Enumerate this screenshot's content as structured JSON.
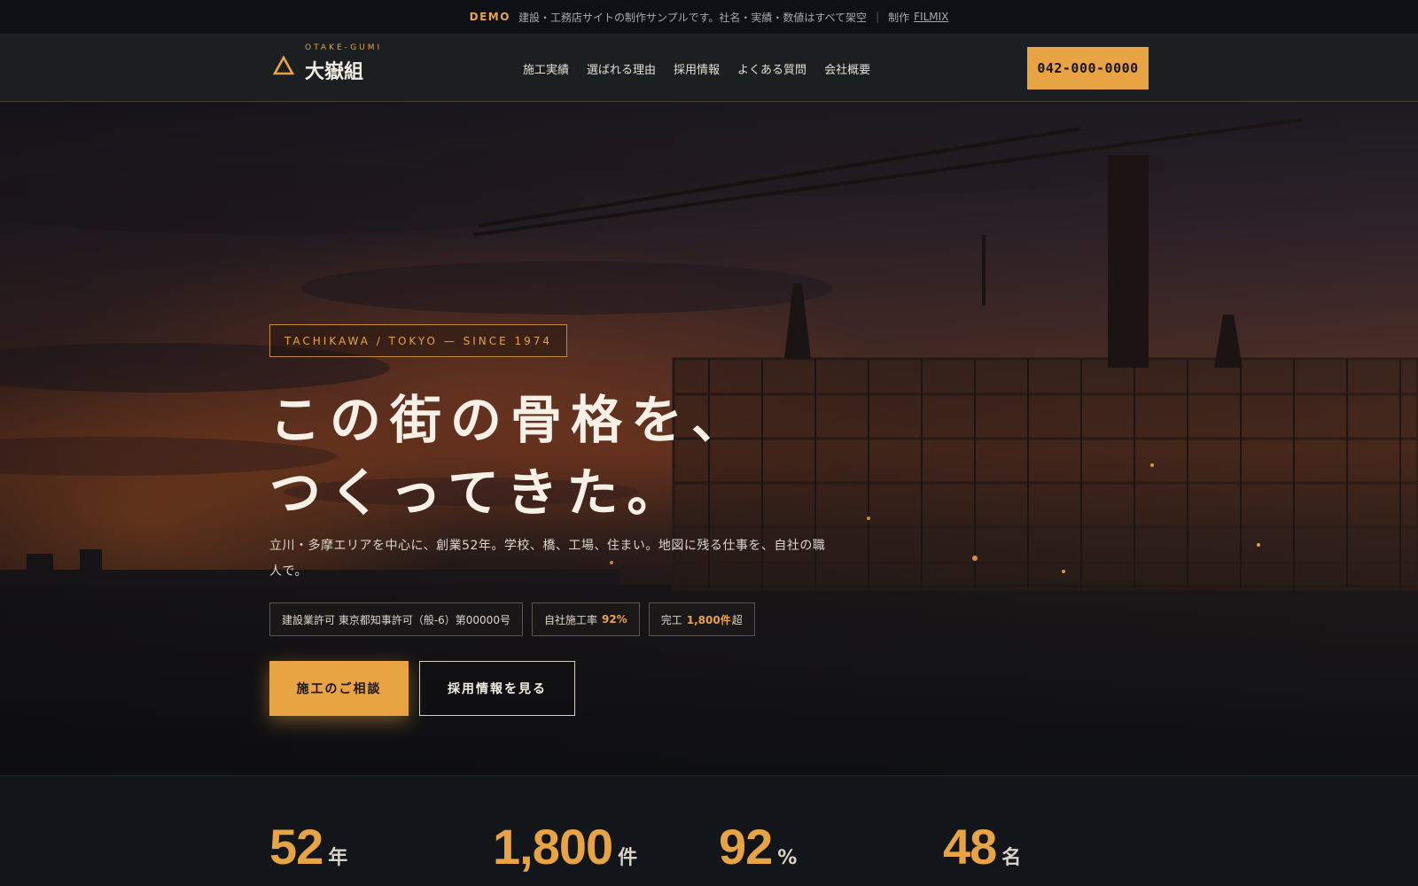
{
  "demo_bar": {
    "tag": "DEMO",
    "message": "建設・工務店サイトの制作サンプルです。社名・実績・数値はすべて架空",
    "separator": "|",
    "credit_prefix": "制作",
    "credit_link": "FILMIX"
  },
  "header": {
    "logo_en": "OTAKE-GUMI",
    "logo_ja": "大嶽組",
    "nav": [
      "施工実績",
      "選ばれる理由",
      "採用情報",
      "よくある質問",
      "会社概要"
    ],
    "tel": "042-000-0000"
  },
  "hero": {
    "eyebrow": "TACHIKAWA / TOKYO — SINCE 1974",
    "headline_line1": "この街の骨格を、",
    "headline_line2": "つくってきた。",
    "lead": "立川・多摩エリアを中心に、創業52年。学校、橋、工場、住まい。地図に残る仕事を、自社の職人で。",
    "chips": [
      {
        "text": "建設業許可 東京都知事許可（般-6）第00000号",
        "num": "",
        "suffix": ""
      },
      {
        "text": "自社施工率",
        "num": "92%",
        "suffix": ""
      },
      {
        "text": "完工",
        "num": "1,800件",
        "suffix": "超"
      }
    ],
    "cta_primary": "施工のご相談",
    "cta_secondary": "採用情報を見る"
  },
  "stats": [
    {
      "num": "52",
      "unit": "年"
    },
    {
      "num": "1,800",
      "unit": "件"
    },
    {
      "num": "92",
      "unit": "%"
    },
    {
      "num": "48",
      "unit": "名"
    }
  ],
  "colors": {
    "accent": "#e8a342",
    "background": "#111418",
    "header": "#1b1f22"
  },
  "icons": {
    "logo": "triangle-logo-icon"
  }
}
